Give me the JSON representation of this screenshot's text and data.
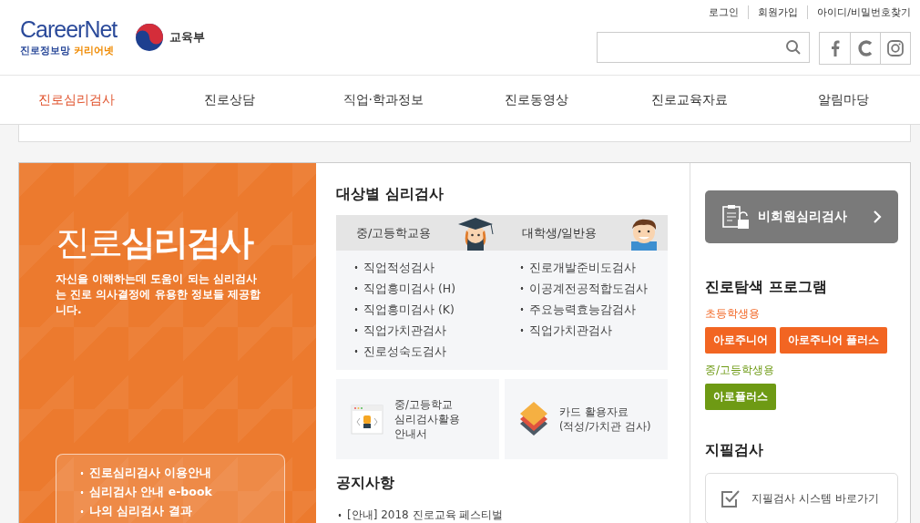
{
  "header": {
    "logo_text": "CareerNet",
    "logo_subtitle_a": "진로정보망",
    "logo_subtitle_b": "커리어넷",
    "ministry": "교육부",
    "top_links": [
      "로그인",
      "회원가입",
      "아이디/비밀번호찾기"
    ]
  },
  "nav": [
    {
      "label": "진로심리검사",
      "selected": true
    },
    {
      "label": "진로상담",
      "selected": false
    },
    {
      "label": "직업·학과정보",
      "selected": false
    },
    {
      "label": "진로동영상",
      "selected": false
    },
    {
      "label": "진로교육자료",
      "selected": false
    },
    {
      "label": "알림마당",
      "selected": false
    }
  ],
  "hero": {
    "title_a": "진로",
    "title_b": "심리검사",
    "description": "자신을 이해하는데 도움이 되는 심리검사는 진로 의사결정에 유용한 정보들 제공합니다.",
    "links": [
      "진로심리검사 이용안내",
      "심리검사 안내 e-book",
      "나의 심리검사 결과"
    ]
  },
  "tests": {
    "title": "대상별 심리검사",
    "columns": [
      {
        "heading": "중/고등학교용",
        "kind": "graduate",
        "items": [
          "직업적성검사",
          "직업흥미검사 (H)",
          "직업흥미검사 (K)",
          "직업가치관검사",
          "진로성숙도검사"
        ]
      },
      {
        "heading": "대학생/일반용",
        "kind": "boy",
        "items": [
          "진로개발준비도검사",
          "이공계전공적합도검사",
          "주요능력효능감검사",
          "직업가치관검사"
        ]
      }
    ]
  },
  "resources": [
    {
      "kind": "browser",
      "lines": [
        "중/고등학교",
        "심리검사활용",
        "안내서"
      ]
    },
    {
      "kind": "cards",
      "lines": [
        "카드 활용자료",
        "(적성/가치관 검사)"
      ]
    }
  ],
  "notices": {
    "title": "공지사항",
    "items": [
      "[안내] 2018 진로교육 페스티벌"
    ]
  },
  "sidebar": {
    "guest_button": "비회원심리검사",
    "program_title": "진로탐색 프로그램",
    "groups": [
      {
        "label": "초등학생용",
        "color": "#f26522",
        "buttons": [
          "아로주니어",
          "아로주니어 플러스"
        ]
      },
      {
        "label": "중/고등학생용",
        "color": "#6e9a14",
        "buttons": [
          "아로플러스"
        ]
      }
    ],
    "paper_title": "지필검사",
    "paper_link": "지필검사 시스템 바로가기"
  }
}
